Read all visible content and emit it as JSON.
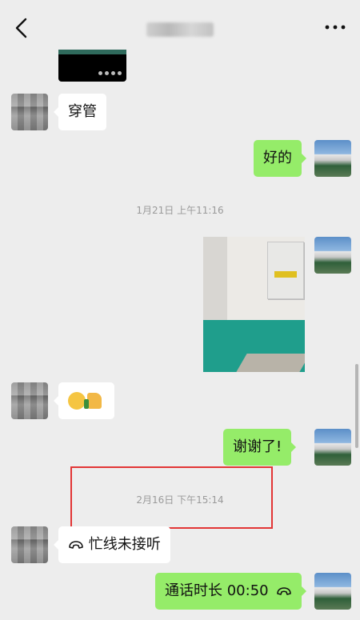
{
  "header": {
    "back_icon": "chevron-left-icon",
    "more_icon": "more-horizontal-icon"
  },
  "messages": {
    "m1_text": "穿管",
    "m2_text": "好的",
    "ts1": "1月21日 上午11:16",
    "m5_text": "谢谢了!",
    "ts2": "2月16日 下午15:14",
    "call_missed_text": "忙线未接听",
    "call_duration_text": "通话时长 00:50"
  },
  "colors": {
    "background": "#ededed",
    "bubble_self": "#95ec69",
    "bubble_other": "#ffffff",
    "highlight_box": "#e23636"
  }
}
